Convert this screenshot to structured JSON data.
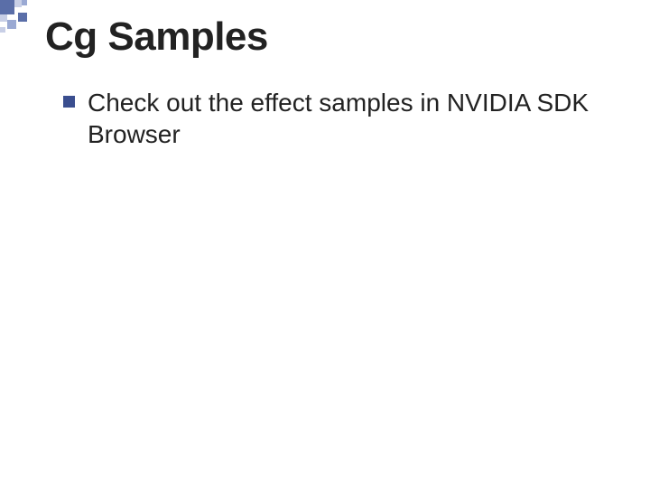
{
  "slide": {
    "title": "Cg Samples",
    "bullets": [
      {
        "text": "Check out the effect samples in NVIDIA SDK Browser"
      }
    ]
  }
}
